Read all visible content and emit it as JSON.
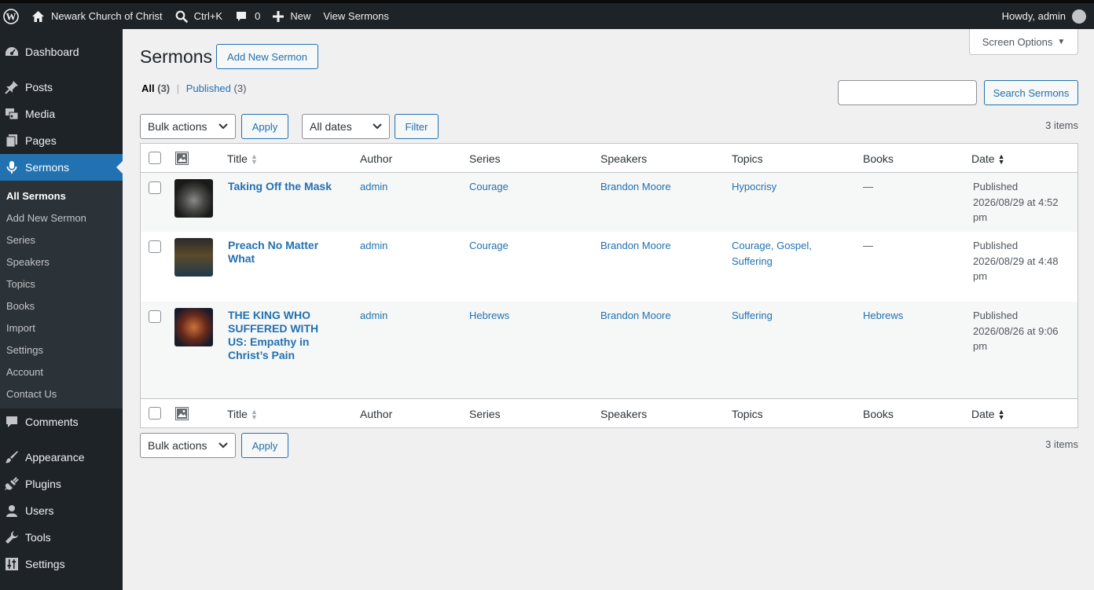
{
  "adminbar": {
    "site_name": "Newark Church of Christ",
    "search_shortcut": "Ctrl+K",
    "comments_count": "0",
    "new_label": "New",
    "view_label": "View Sermons",
    "greeting": "Howdy, admin"
  },
  "sidebar": {
    "dashboard": "Dashboard",
    "posts": "Posts",
    "media": "Media",
    "pages": "Pages",
    "sermons": "Sermons",
    "submenu": [
      "All Sermons",
      "Add New Sermon",
      "Series",
      "Speakers",
      "Topics",
      "Books",
      "Import",
      "Settings",
      "Account",
      "Contact Us"
    ],
    "comments": "Comments",
    "appearance": "Appearance",
    "plugins": "Plugins",
    "users": "Users",
    "tools": "Tools",
    "settings": "Settings"
  },
  "page": {
    "title": "Sermons",
    "add_new": "Add New Sermon",
    "screen_options": "Screen Options",
    "filter_all": "All",
    "filter_all_count": "(3)",
    "filter_published": "Published",
    "filter_published_count": "(3)",
    "search_button": "Search Sermons",
    "bulk_actions": "Bulk actions",
    "apply": "Apply",
    "all_dates": "All dates",
    "filter": "Filter",
    "items_count": "3 items"
  },
  "table": {
    "columns": {
      "title": "Title",
      "author": "Author",
      "series": "Series",
      "speakers": "Speakers",
      "topics": "Topics",
      "books": "Books",
      "date": "Date"
    },
    "rows": [
      {
        "title": "Taking Off the Mask",
        "author": "admin",
        "series": "Courage",
        "speakers": "Brandon Moore",
        "topics": "Hypocrisy",
        "books": "—",
        "date_status": "Published",
        "date_value": "2026/08/29 at 4:52 pm",
        "thumb_color": "#3a3a3a"
      },
      {
        "title": "Preach No Matter What",
        "author": "admin",
        "series": "Courage",
        "speakers": "Brandon Moore",
        "topics": "Courage, Gospel, Suffering",
        "books": "—",
        "date_status": "Published",
        "date_value": "2026/08/29 at 4:48 pm",
        "thumb_color": "#5a4a2a"
      },
      {
        "title": "THE KING WHO SUFFERED WITH US: Empathy in Christ’s Pain",
        "author": "admin",
        "series": "Hebrews",
        "speakers": "Brandon Moore",
        "topics": "Suffering",
        "books": "Hebrews",
        "date_status": "Published",
        "date_value": "2026/08/26 at 9:06 pm",
        "thumb_color": "#6a2a1a"
      }
    ]
  },
  "colors": {
    "adminbar_bg": "#1d2327",
    "sidebar_bg": "#1d2327",
    "accent": "#2271b1",
    "page_bg": "#f0f0f1"
  }
}
